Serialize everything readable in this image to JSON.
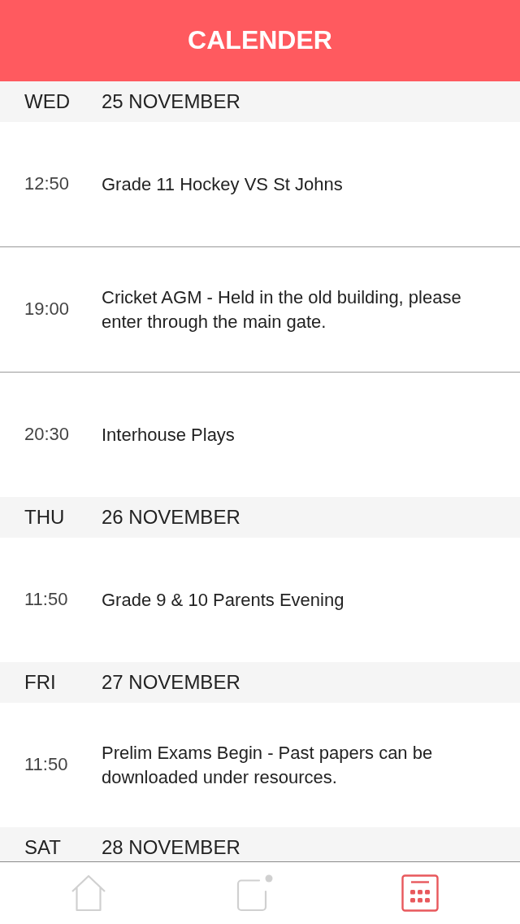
{
  "header": {
    "title": "CALENDER"
  },
  "days": [
    {
      "weekday": "WED",
      "date": "25 NOVEMBER",
      "events": [
        {
          "time": "12:50",
          "title": "Grade 11 Hockey VS St Johns"
        },
        {
          "time": "19:00",
          "title": "Cricket AGM - Held in the old building, please enter through the main gate."
        },
        {
          "time": "20:30",
          "title": "Interhouse Plays"
        }
      ]
    },
    {
      "weekday": "THU",
      "date": "26 NOVEMBER",
      "events": [
        {
          "time": "11:50",
          "title": "Grade 9 & 10 Parents Evening"
        }
      ]
    },
    {
      "weekday": "FRI",
      "date": "27 NOVEMBER",
      "events": [
        {
          "time": "11:50",
          "title": "Prelim Exams Begin - Past papers can be downloaded under resources."
        }
      ]
    },
    {
      "weekday": "SAT",
      "date": "28 NOVEMBER"
    }
  ],
  "tabs": [
    {
      "kind": "home",
      "selected": false
    },
    {
      "kind": "notes",
      "selected": false
    },
    {
      "kind": "calendar",
      "selected": true
    }
  ]
}
